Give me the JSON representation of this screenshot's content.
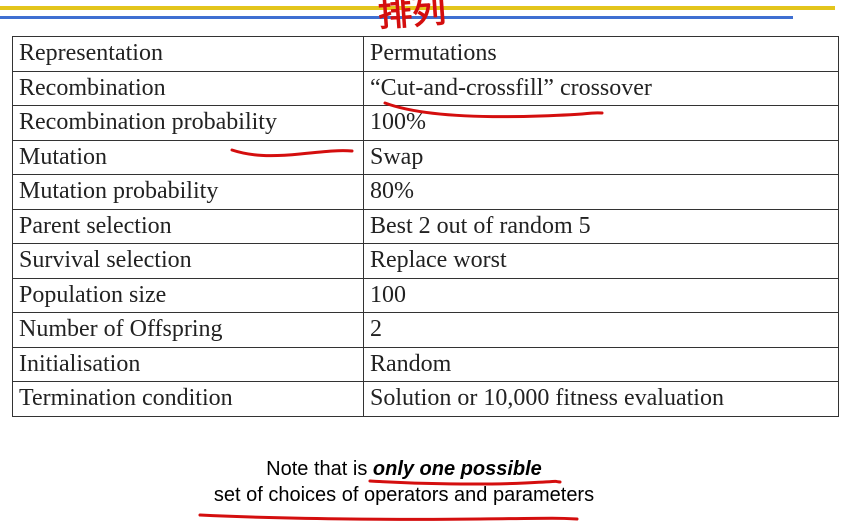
{
  "annotation": {
    "handwritten_text": "排列"
  },
  "table": {
    "rows": [
      {
        "key": "Representation",
        "value": "Permutations"
      },
      {
        "key": "Recombination",
        "value": "“Cut-and-crossfill” crossover"
      },
      {
        "key": "Recombination probability",
        "value": "100%"
      },
      {
        "key": "Mutation",
        "value": "Swap"
      },
      {
        "key": "Mutation probability",
        "value": "80%"
      },
      {
        "key": "Parent selection",
        "value": "Best 2 out of random 5"
      },
      {
        "key": "Survival selection",
        "value": "Replace worst"
      },
      {
        "key": "Population size",
        "value": "100"
      },
      {
        "key": "Number of Offspring",
        "value": "2"
      },
      {
        "key": "Initialisation",
        "value": "Random"
      },
      {
        "key": "Termination condition",
        "value": "Solution or 10,000 fitness evaluation"
      }
    ]
  },
  "note": {
    "prefix": "Note that is ",
    "emphasis": "only one possible",
    "line2": "set of choices of operators and parameters"
  },
  "colors": {
    "annotation_red": "#d40e0e",
    "top_line_yellow": "#e3c51c",
    "top_line_blue": "#3f6fd1"
  }
}
